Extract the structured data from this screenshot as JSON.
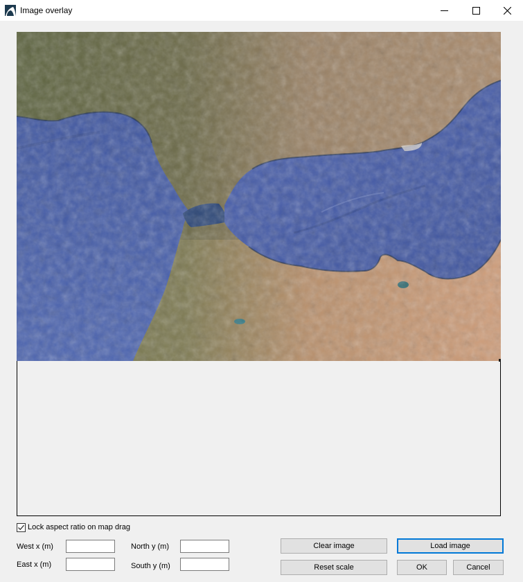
{
  "window": {
    "title": "Image overlay",
    "app_icon": "app-logo-icon",
    "controls": {
      "minimize_icon": "minimize-icon",
      "maximize_icon": "maximize-icon",
      "close_icon": "close-icon"
    }
  },
  "map": {
    "description": "Satellite image of the Strait of Gibraltar (southern Spain and northern Morocco)",
    "colors": {
      "sea": "#4a5fa8",
      "sea_dark": "#2d4a7a",
      "land_green": "#6b6f47",
      "land_tan": "#b48b67",
      "land_desert": "#c99a78"
    }
  },
  "options": {
    "lock_aspect_label": "Lock aspect ratio on map drag",
    "lock_aspect_checked": true
  },
  "fields": {
    "west": {
      "label": "West x (m)",
      "value": ""
    },
    "east": {
      "label": "East x (m)",
      "value": ""
    },
    "north": {
      "label": "North y (m)",
      "value": ""
    },
    "south": {
      "label": "South y (m)",
      "value": ""
    }
  },
  "buttons": {
    "clear_image": "Clear image",
    "load_image": "Load image",
    "reset_scale": "Reset scale",
    "ok": "OK",
    "cancel": "Cancel"
  },
  "accent_color": "#0078d7"
}
